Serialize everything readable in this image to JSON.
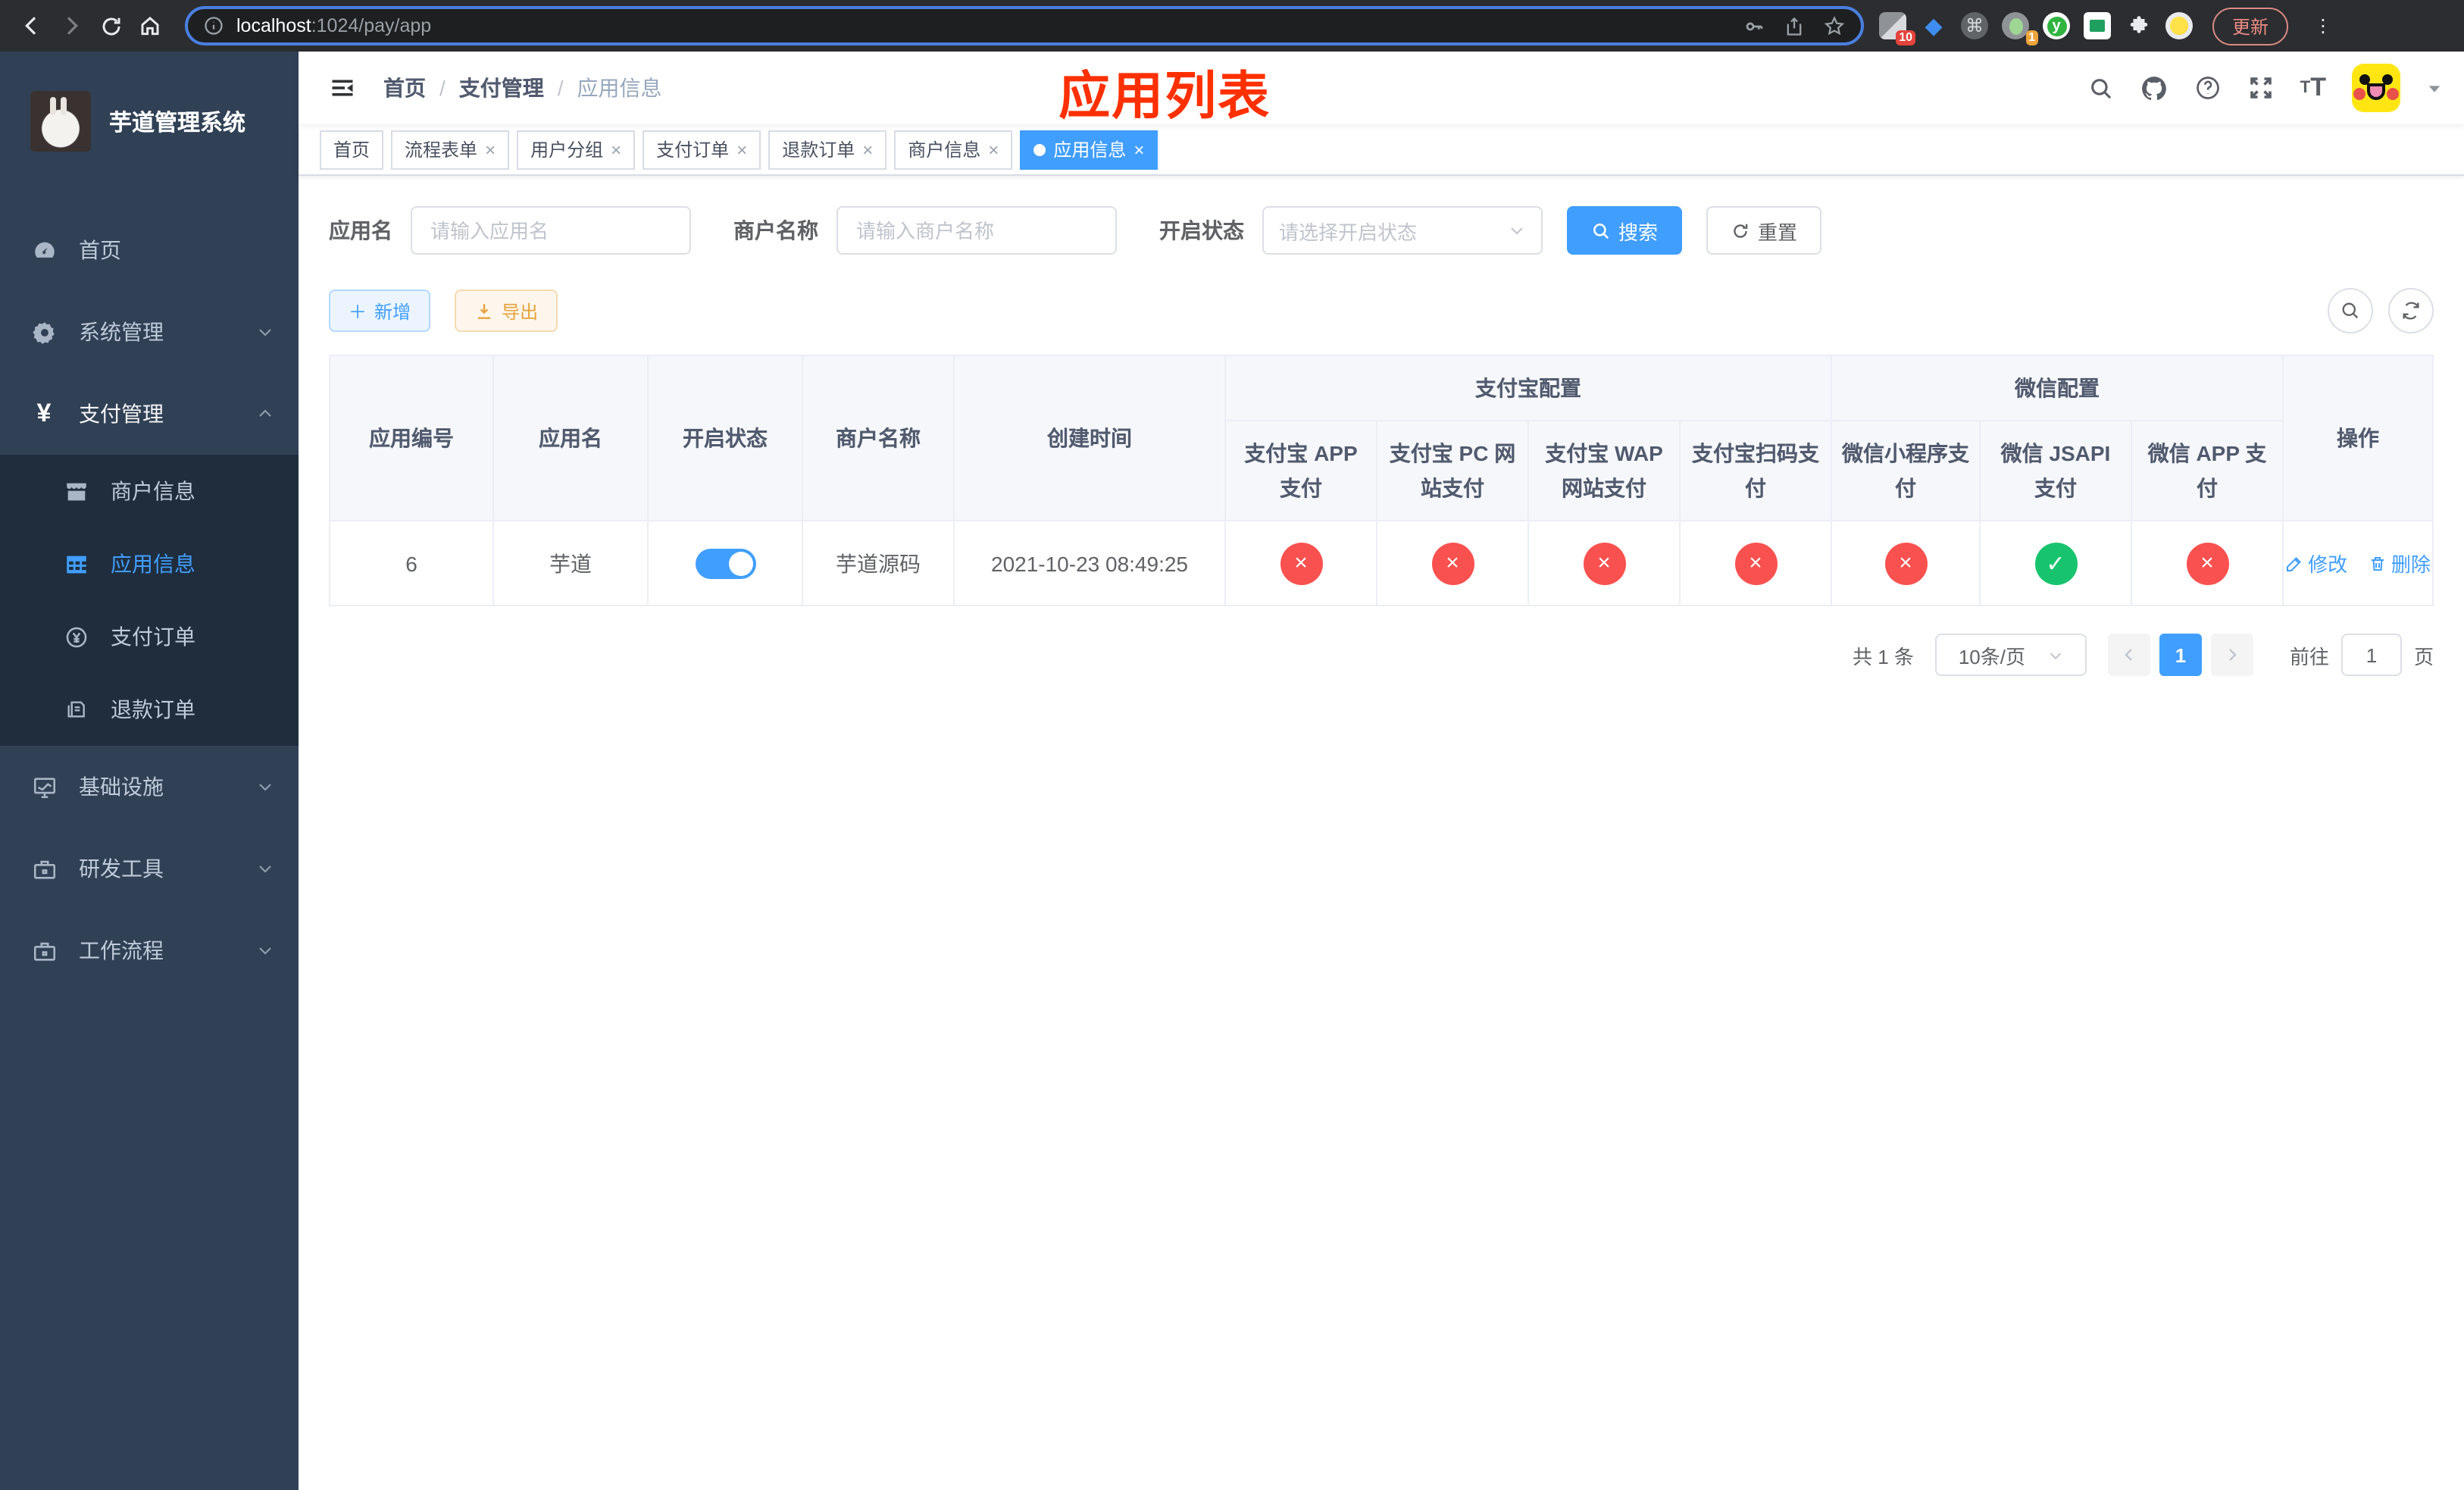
{
  "browser": {
    "url_host": "localhost",
    "url_path": ":1024/pay/app",
    "update_button": "更新",
    "ext_badge_blue_diamond": "10",
    "ext_badge_green_dot": "1"
  },
  "icons": {
    "check": "✓",
    "cross": "×",
    "close": "×",
    "plus": "＋"
  },
  "sidebar": {
    "logo_title": "芋道管理系统",
    "items": {
      "home": "首页",
      "system": "系统管理",
      "payment": "支付管理",
      "merchant": "商户信息",
      "app": "应用信息",
      "pay_order": "支付订单",
      "refund_order": "退款订单",
      "infra": "基础设施",
      "dev_tools": "研发工具",
      "workflow": "工作流程"
    }
  },
  "header": {
    "breadcrumb": [
      "首页",
      "支付管理",
      "应用信息"
    ],
    "separator": "/",
    "overlay_title": "应用列表",
    "overlay_color": "#ff3000"
  },
  "tabs": [
    {
      "label": "首页"
    },
    {
      "label": "流程表单"
    },
    {
      "label": "用户分组"
    },
    {
      "label": "支付订单"
    },
    {
      "label": "退款订单"
    },
    {
      "label": "商户信息"
    },
    {
      "label": "应用信息"
    }
  ],
  "search": {
    "app_name_label": "应用名",
    "app_name_placeholder": "请输入应用名",
    "merchant_label": "商户名称",
    "merchant_placeholder": "请输入商户名称",
    "status_label": "开启状态",
    "status_placeholder": "请选择开启状态",
    "search_button": "搜索",
    "reset_button": "重置"
  },
  "toolbar": {
    "add_button": "新增",
    "export_button": "导出"
  },
  "table": {
    "header": {
      "app_id": "应用编号",
      "app_name": "应用名",
      "status": "开启状态",
      "merchant": "商户名称",
      "created": "创建时间",
      "alipay_group": "支付宝配置",
      "wechat_group": "微信配置",
      "alipay_app": "支付宝 APP 支付",
      "alipay_pc": "支付宝 PC 网站支付",
      "alipay_wap": "支付宝 WAP 网站支付",
      "alipay_qr": "支付宝扫码支付",
      "wx_lite": "微信小程序支付",
      "wx_jsapi": "微信 JSAPI 支付",
      "wx_app": "微信 APP 支付",
      "actions": "操作"
    },
    "rows": [
      {
        "app_id": "6",
        "app_name": "芋道",
        "enabled": true,
        "merchant": "芋道源码",
        "created": "2021-10-23 08:49:25",
        "alipay_app": false,
        "alipay_pc": false,
        "alipay_wap": false,
        "alipay_qr": false,
        "wx_lite": false,
        "wx_jsapi": true,
        "wx_app": false
      }
    ],
    "actions": {
      "edit": "修改",
      "delete": "删除"
    }
  },
  "pagination": {
    "total": "共 1 条",
    "page_size": "10条/页",
    "current_page": "1",
    "goto_label": "前往",
    "goto_value": "1",
    "page_unit": "页"
  },
  "colors": {
    "primary": "#409eff",
    "success_circle": "#17c46d",
    "danger_circle": "#f9514f",
    "sidebar_bg": "#304156",
    "submenu_bg": "#1f2d3d",
    "warning_text": "#e6a23c"
  }
}
